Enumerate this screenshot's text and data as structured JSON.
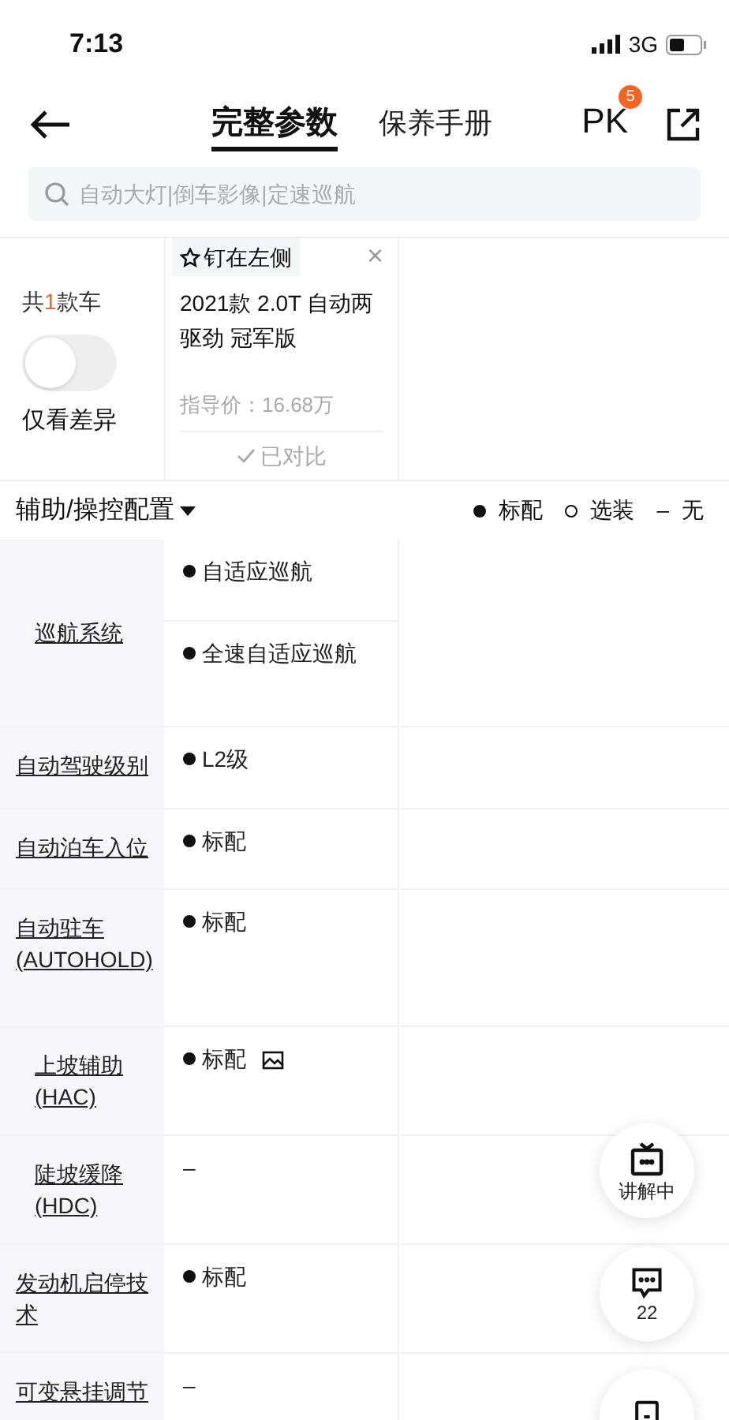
{
  "status_bar": {
    "time": "7:13",
    "network": "3G"
  },
  "nav": {
    "tabs": [
      {
        "label": "完整参数",
        "selected": true
      },
      {
        "label": "保养手册",
        "selected": false
      }
    ],
    "pk": {
      "label": "PK",
      "badge": "5"
    }
  },
  "search": {
    "placeholder": "自动大灯|倒车影像|定速巡航"
  },
  "compare_header": {
    "summary": {
      "prefix": "共",
      "count": "1",
      "suffix": "款车"
    },
    "diff_toggle": {
      "on": false,
      "label": "仅看差异"
    },
    "cars": [
      {
        "pin_label": "钉在左侧",
        "close": "×",
        "title": "2021款 2.0T 自动两驱劲 冠军版",
        "price": "指导价：16.68万",
        "compared_label": "已对比"
      }
    ]
  },
  "section": {
    "title": "辅助/操控配置",
    "legend": [
      {
        "kind": "standard",
        "label": "标配"
      },
      {
        "kind": "optional",
        "label": "选装"
      },
      {
        "kind": "none",
        "label": "无",
        "symbol": "–"
      }
    ]
  },
  "rows": [
    {
      "label": "巡航系统",
      "centered": true,
      "values": [
        {
          "kind": "standard",
          "text": "自适应巡航"
        },
        {
          "kind": "standard",
          "text": "全速自适应巡航"
        }
      ]
    },
    {
      "label": "自动驾驶级别",
      "centered": false,
      "values": [
        {
          "kind": "standard",
          "text": "L2级"
        }
      ]
    },
    {
      "label": "自动泊车入位",
      "centered": false,
      "values": [
        {
          "kind": "standard",
          "text": "标配"
        }
      ]
    },
    {
      "label": "自动驻车(AUTOHOLD)",
      "centered": false,
      "values": [
        {
          "kind": "standard",
          "text": "标配"
        }
      ]
    },
    {
      "label": "上坡辅助(HAC)",
      "centered": true,
      "values": [
        {
          "kind": "standard",
          "text": "标配",
          "has_image": true
        }
      ]
    },
    {
      "label": "陡坡缓降(HDC)",
      "centered": true,
      "values": [
        {
          "kind": "none",
          "text": "–"
        }
      ]
    },
    {
      "label": "发动机启停技术",
      "centered": false,
      "values": [
        {
          "kind": "standard",
          "text": "标配"
        }
      ]
    },
    {
      "label": "可变悬挂调节",
      "centered": false,
      "values": [
        {
          "kind": "none",
          "text": "–"
        }
      ]
    }
  ],
  "floating": [
    {
      "kind": "live",
      "label": "讲解中"
    },
    {
      "kind": "comments",
      "label": "22"
    },
    {
      "kind": "more"
    }
  ]
}
